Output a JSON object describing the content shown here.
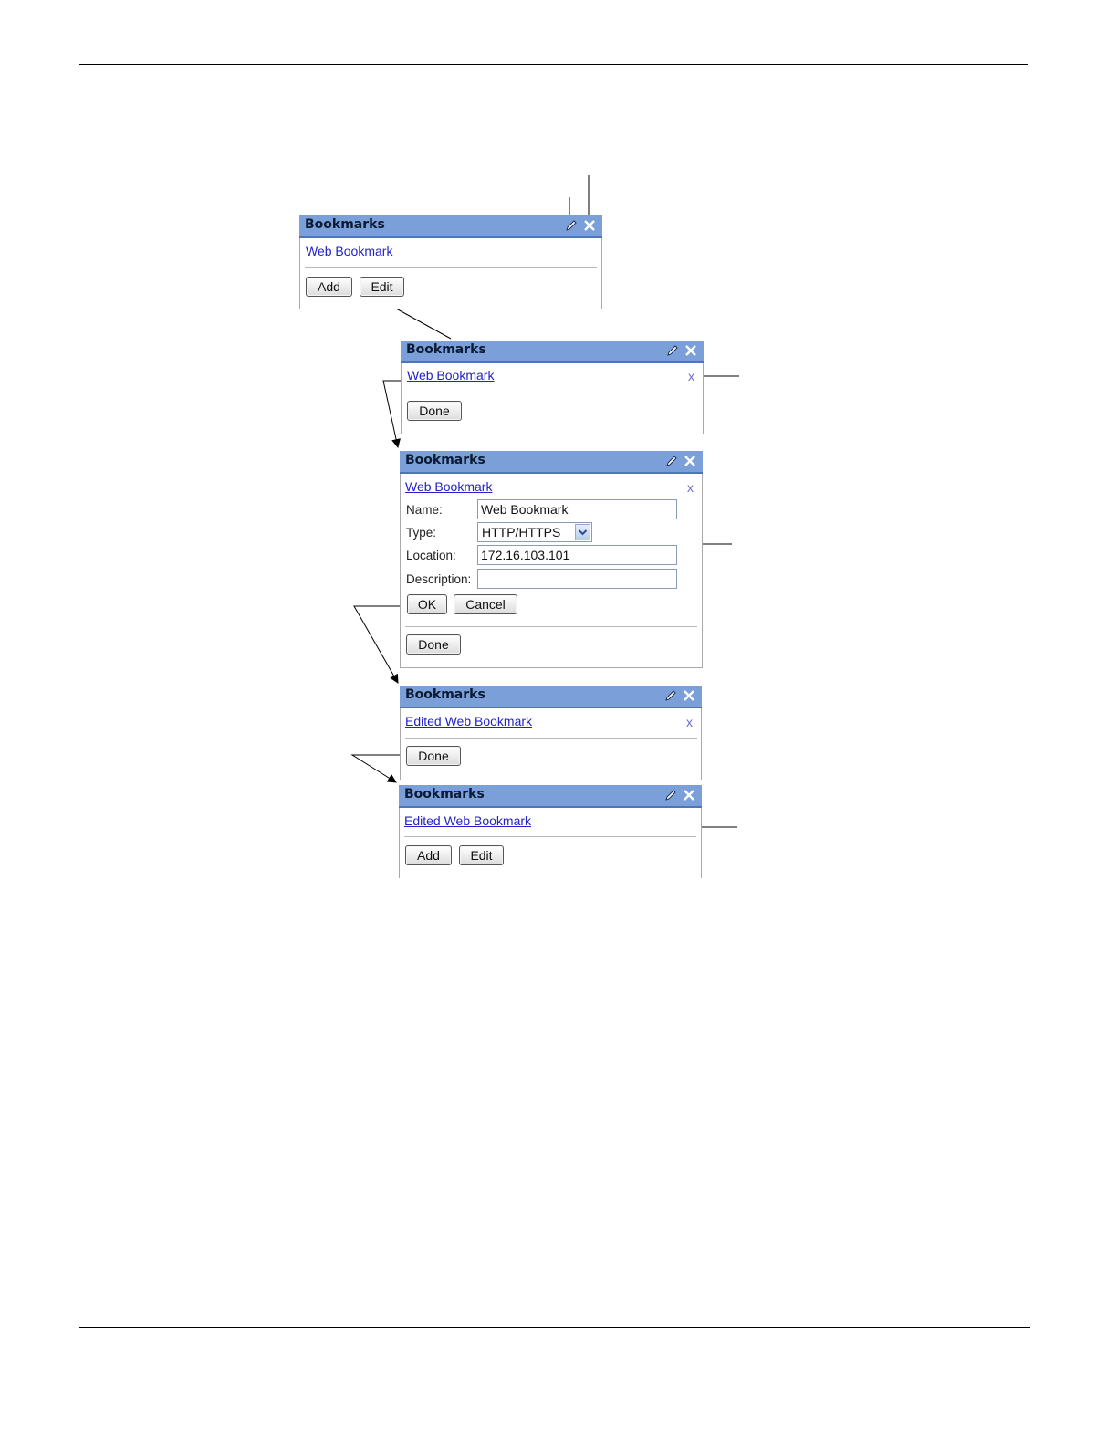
{
  "panels": [
    {
      "title": "Bookmarks",
      "link": "Web Bookmark",
      "buttons": [
        "Add",
        "Edit"
      ]
    },
    {
      "title": "Bookmarks",
      "link": "Web Bookmark",
      "delete": "x",
      "buttons": [
        "Done"
      ]
    },
    {
      "title": "Bookmarks",
      "link": "Web Bookmark",
      "delete": "x",
      "form": {
        "name_label": "Name:",
        "name_value": "Web Bookmark",
        "type_label": "Type:",
        "type_value": "HTTP/HTTPS",
        "location_label": "Location:",
        "location_value": "172.16.103.101",
        "description_label": "Description:",
        "description_value": "",
        "ok": "OK",
        "cancel": "Cancel"
      },
      "buttons": [
        "Done"
      ]
    },
    {
      "title": "Bookmarks",
      "link": "Edited Web Bookmark",
      "delete": "x",
      "buttons": [
        "Done"
      ]
    },
    {
      "title": "Bookmarks",
      "link": "Edited Web Bookmark",
      "buttons": [
        "Add",
        "Edit"
      ]
    }
  ],
  "icons": {
    "edit": "pencil-icon",
    "close": "close-icon"
  },
  "colors": {
    "header": "#7b9fd9",
    "link": "#2222c8"
  }
}
